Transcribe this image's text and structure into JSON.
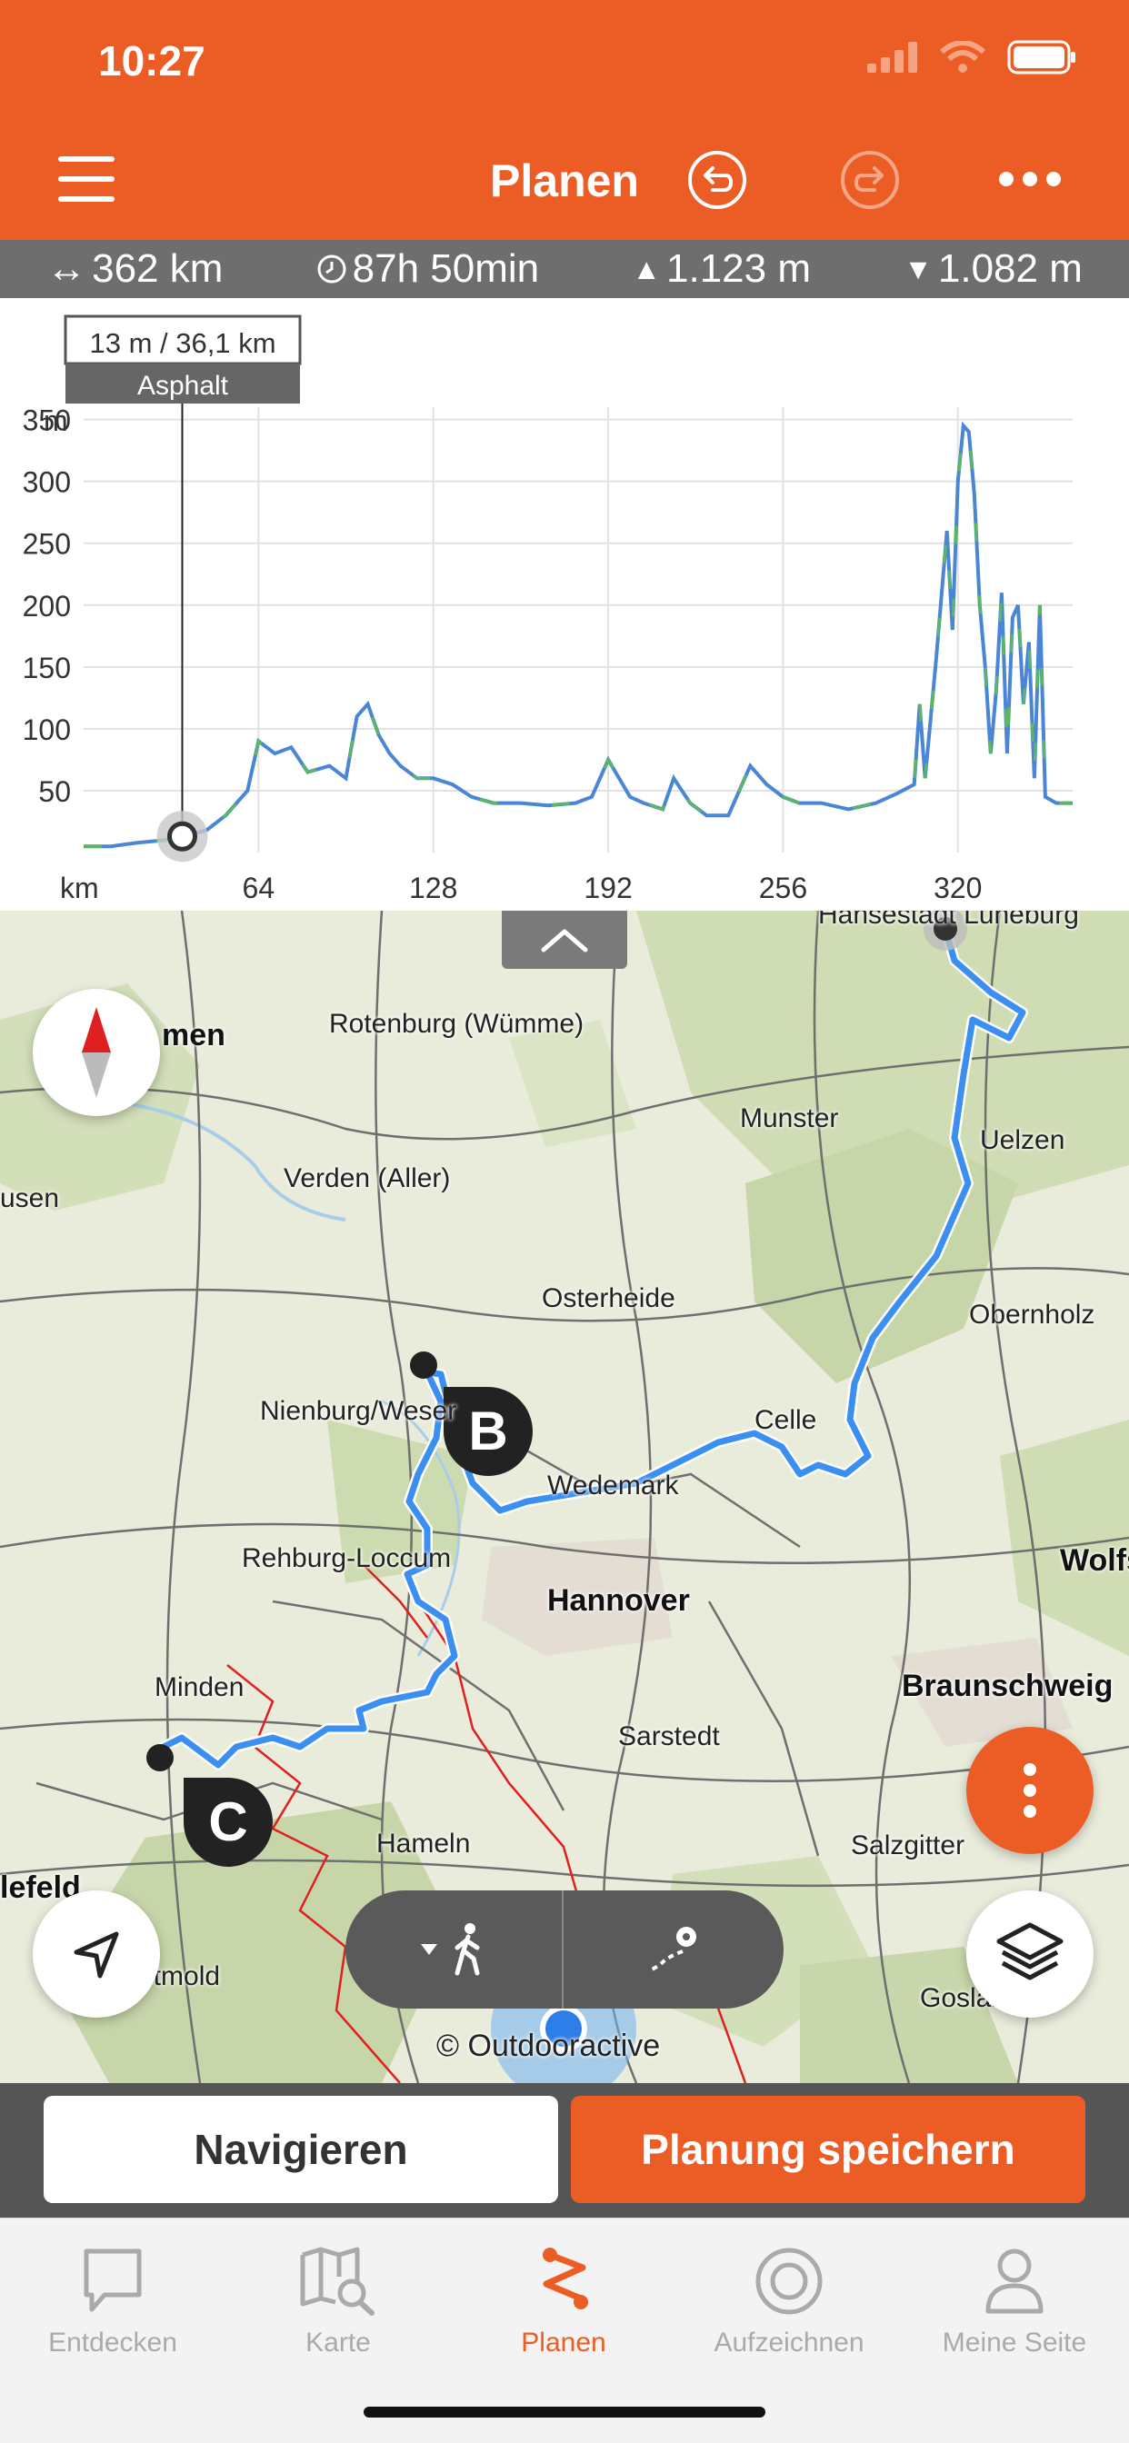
{
  "status_bar": {
    "time": "10:27"
  },
  "header": {
    "title": "Planen"
  },
  "stats": {
    "distance": "362 km",
    "duration": "87h 50min",
    "ascent": "1.123 m",
    "descent": "1.082 m"
  },
  "elevation_chart": {
    "tooltip_value": "13 m / 36,1 km",
    "tooltip_surface": "Asphalt",
    "y_unit": "m",
    "x_unit": "km"
  },
  "chart_data": {
    "type": "line",
    "title": "",
    "xlabel": "km",
    "ylabel": "m",
    "xlim": [
      0,
      362
    ],
    "ylim": [
      0,
      360
    ],
    "x_ticks": [
      64,
      128,
      192,
      256,
      320
    ],
    "y_ticks": [
      50,
      100,
      150,
      200,
      250,
      300,
      350
    ],
    "grid": true,
    "series": [
      {
        "x": [
          0,
          10,
          20,
          30,
          36.1,
          45,
          52,
          60,
          64,
          70,
          76,
          82,
          90,
          96,
          100,
          104,
          108,
          112,
          116,
          122,
          128,
          135,
          142,
          150,
          160,
          170,
          180,
          186,
          192,
          196,
          200,
          205,
          212,
          216,
          222,
          228,
          236,
          244,
          250,
          256,
          262,
          270,
          280,
          290,
          298,
          304,
          306,
          308,
          312,
          316,
          318,
          320,
          322,
          324,
          326,
          328,
          330,
          332,
          334,
          336,
          338,
          340,
          342,
          344,
          346,
          348,
          350,
          352,
          356,
          362
        ],
        "y": [
          5,
          5,
          8,
          10,
          13,
          18,
          30,
          50,
          90,
          80,
          85,
          65,
          70,
          60,
          110,
          120,
          95,
          80,
          70,
          60,
          60,
          55,
          45,
          40,
          40,
          38,
          40,
          45,
          75,
          60,
          45,
          40,
          35,
          60,
          40,
          30,
          30,
          70,
          55,
          45,
          40,
          40,
          35,
          40,
          48,
          55,
          120,
          60,
          155,
          260,
          180,
          300,
          345,
          340,
          290,
          200,
          150,
          80,
          130,
          210,
          80,
          190,
          200,
          120,
          170,
          60,
          200,
          45,
          40,
          40
        ]
      }
    ]
  },
  "map": {
    "cities": [
      "Rotenburg (Wümme)",
      "Munster",
      "Uelzen",
      "Verden (Aller)",
      "Osterheide",
      "Obernholz",
      "Nienburg/Weser",
      "Celle",
      "Wedemark",
      "Rehburg-Loccum",
      "Hannover",
      "Wolfs",
      "Minden",
      "Braunschweig",
      "Sarstedt",
      "Hameln",
      "Salzgitter",
      "Goslar",
      "etmold",
      "lefeld",
      "usen",
      "men",
      "Hansestadt Lüneburg"
    ],
    "waypoint_b": "B",
    "waypoint_c": "C",
    "attribution": "© Outdooractive"
  },
  "actions": {
    "navigate": "Navigieren",
    "save": "Planung speichern"
  },
  "tabs": [
    {
      "label": "Entdecken",
      "icon": "chat-bubble-icon"
    },
    {
      "label": "Karte",
      "icon": "map-search-icon"
    },
    {
      "label": "Planen",
      "icon": "route-icon"
    },
    {
      "label": "Aufzeichnen",
      "icon": "record-icon"
    },
    {
      "label": "Meine Seite",
      "icon": "person-icon"
    }
  ],
  "colors": {
    "accent": "#ec5d25",
    "route": "#3b8ff0",
    "trail": "#e02020"
  }
}
